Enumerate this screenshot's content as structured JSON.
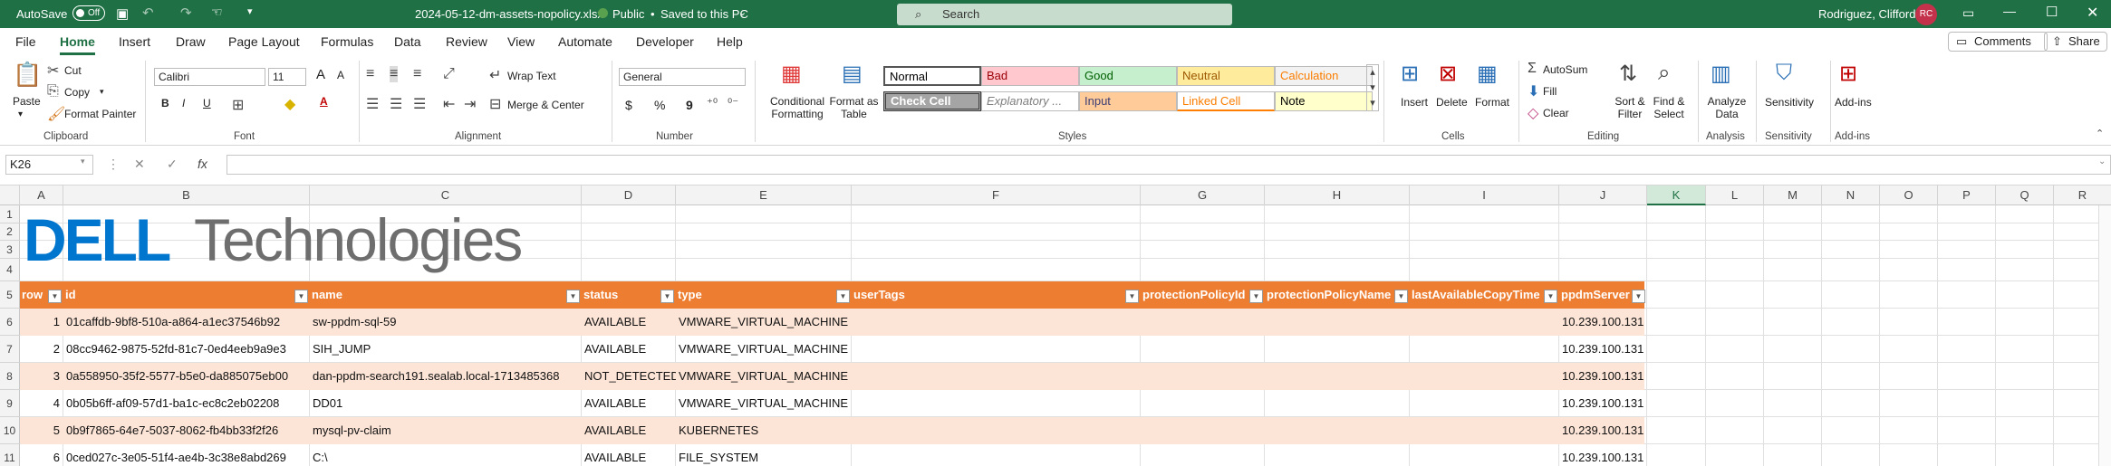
{
  "titlebar": {
    "autosave_label": "AutoSave",
    "autosave_state": "Off",
    "filename": "2024-05-12-dm-assets-nopolicy.xlsx",
    "visibility": "Public",
    "save_status": "Saved to this PC",
    "search_placeholder": "Search",
    "user_name": "Rodriguez, Clifford",
    "user_initials": "RC"
  },
  "menu": {
    "tabs": [
      "File",
      "Home",
      "Draw",
      "Page Layout",
      "Formulas",
      "Data",
      "Review",
      "View",
      "Automate",
      "Developer",
      "Help"
    ],
    "active": "Home",
    "comments_label": "Comments",
    "share_label": "Share"
  },
  "ribbon": {
    "clipboard": {
      "paste": "Paste",
      "cut": "Cut",
      "copy": "Copy",
      "format_painter": "Format Painter",
      "label": "Clipboard"
    },
    "font": {
      "name": "Calibri",
      "size": "11",
      "label": "Font",
      "bold": "B",
      "italic": "I",
      "underline": "U",
      "grow": "A",
      "shrink": "A"
    },
    "alignment": {
      "wrap_text": "Wrap Text",
      "merge_center": "Merge & Center",
      "label": "Alignment"
    },
    "number": {
      "format": "General",
      "label": "Number",
      "currency": "$",
      "percent": "%",
      "comma": "9"
    },
    "styles": {
      "conditional": "Conditional Formatting",
      "format_table": "Format as Table",
      "label": "Styles",
      "cells": [
        {
          "name": "Normal",
          "bg": "#ffffff",
          "fg": "#000000"
        },
        {
          "name": "Bad",
          "bg": "#ffc7ce",
          "fg": "#9c0006"
        },
        {
          "name": "Good",
          "bg": "#c6efce",
          "fg": "#006100"
        },
        {
          "name": "Neutral",
          "bg": "#ffeb9c",
          "fg": "#9c5700"
        },
        {
          "name": "Calculation",
          "bg": "#f2f2f2",
          "fg": "#fa7d00"
        },
        {
          "name": "Check Cell",
          "bg": "#a5a5a5",
          "fg": "#ffffff"
        },
        {
          "name": "Explanatory ...",
          "bg": "#ffffff",
          "fg": "#7f7f7f"
        },
        {
          "name": "Input",
          "bg": "#ffcc99",
          "fg": "#3f3f76"
        },
        {
          "name": "Linked Cell",
          "bg": "#ffffff",
          "fg": "#fa7d00"
        },
        {
          "name": "Note",
          "bg": "#ffffcc",
          "fg": "#000000"
        }
      ]
    },
    "cells": {
      "insert": "Insert",
      "delete": "Delete",
      "format": "Format",
      "label": "Cells"
    },
    "editing": {
      "autosum": "AutoSum",
      "fill": "Fill",
      "clear": "Clear",
      "sort_filter": "Sort & Filter",
      "find_select": "Find & Select",
      "label": "Editing"
    },
    "analysis": {
      "analyze": "Analyze Data",
      "label": "Analysis"
    },
    "sensitivity": {
      "button": "Sensitivity",
      "label": "Sensitivity"
    },
    "addins": {
      "button": "Add-ins",
      "label": "Add-ins"
    }
  },
  "formula_bar": {
    "name_box": "K26",
    "formula": "",
    "fx": "fx"
  },
  "columns": [
    "A",
    "B",
    "C",
    "D",
    "E",
    "F",
    "G",
    "H",
    "I",
    "J",
    "K",
    "L",
    "M",
    "N",
    "O",
    "P",
    "Q",
    "R"
  ],
  "selected_column": "K",
  "row_numbers": [
    "1",
    "2",
    "3",
    "4",
    "5",
    "6",
    "7",
    "8",
    "9",
    "10",
    "11"
  ],
  "logo": {
    "brand": "DELL",
    "product": "Technologies"
  },
  "table": {
    "headers": [
      "row",
      "id",
      "name",
      "status",
      "type",
      "userTags",
      "protectionPolicyId",
      "protectionPolicyName",
      "lastAvailableCopyTime",
      "ppdmServer"
    ],
    "header_bg": "#ed7d31",
    "band_bg": "#fce4d6",
    "rows": [
      [
        "1",
        "01caffdb-9bf8-510a-a864-a1ec37546b92",
        "sw-ppdm-sql-59",
        "AVAILABLE",
        "VMWARE_VIRTUAL_MACHINE",
        "",
        "",
        "",
        "",
        "10.239.100.131"
      ],
      [
        "2",
        "08cc9462-9875-52fd-81c7-0ed4eeb9a9e3",
        "SIH_JUMP",
        "AVAILABLE",
        "VMWARE_VIRTUAL_MACHINE",
        "",
        "",
        "",
        "",
        "10.239.100.131"
      ],
      [
        "3",
        "0a558950-35f2-5577-b5e0-da885075eb00",
        "dan-ppdm-search191.sealab.local-1713485368",
        "NOT_DETECTED",
        "VMWARE_VIRTUAL_MACHINE",
        "",
        "",
        "",
        "",
        "10.239.100.131"
      ],
      [
        "4",
        "0b05b6ff-af09-57d1-ba1c-ec8c2eb02208",
        "DD01",
        "AVAILABLE",
        "VMWARE_VIRTUAL_MACHINE",
        "",
        "",
        "",
        "",
        "10.239.100.131"
      ],
      [
        "5",
        "0b9f7865-64e7-5037-8062-fb4bb33f2f26",
        "mysql-pv-claim",
        "AVAILABLE",
        "KUBERNETES",
        "",
        "",
        "",
        "",
        "10.239.100.131"
      ],
      [
        "6",
        "0ced027c-3e05-51f4-ae4b-3c38e8abd269",
        "C:\\",
        "AVAILABLE",
        "FILE_SYSTEM",
        "",
        "",
        "",
        "",
        "10.239.100.131"
      ]
    ]
  }
}
